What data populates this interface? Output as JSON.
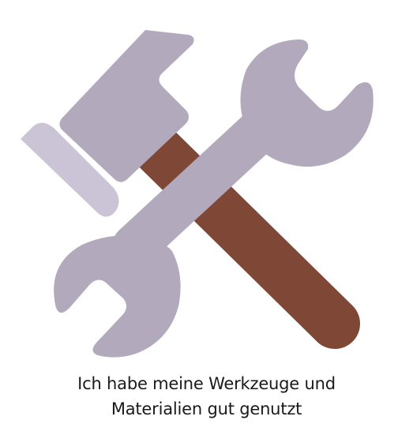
{
  "illustration": {
    "icon": "hammer-and-wrench-icon",
    "colors": {
      "hammer_head": "#b2aabc",
      "hammer_face": "#cac4d6",
      "hammer_handle": "#7f4735",
      "wrench": "#b2aabc"
    }
  },
  "caption": {
    "line1": "Ich habe meine Werkzeuge und",
    "line2": "Materialien gut genutzt"
  }
}
